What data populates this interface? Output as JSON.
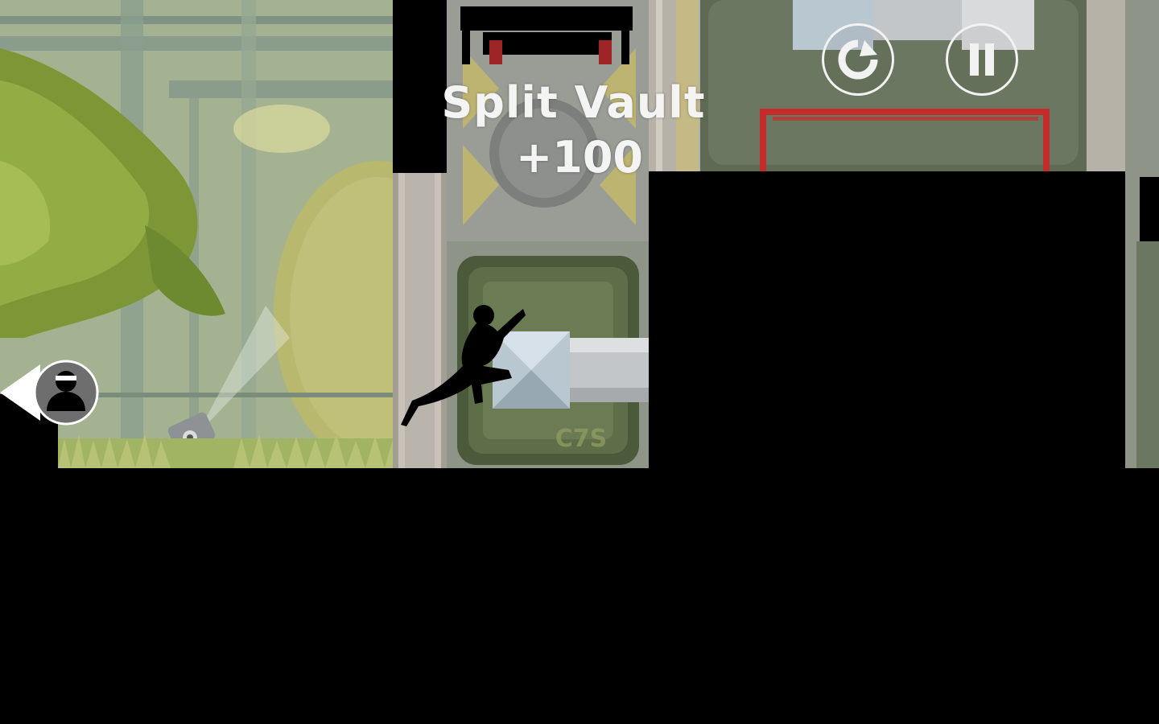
{
  "hud": {
    "restart_icon": "restart-icon",
    "pause_icon": "pause-icon"
  },
  "trick": {
    "name": "Split Vault",
    "score": "+100"
  },
  "scene": {
    "crate_label": "C7S",
    "colors": {
      "sky": "#9fae8c",
      "foliage": "#8aa23a",
      "wall": "#8f9488",
      "crate": "#5d6e48",
      "rail": "#c42b2b",
      "hazard_yellow": "#d6c35a"
    }
  },
  "chaser": {
    "icon": "hunter-silhouette-icon"
  }
}
